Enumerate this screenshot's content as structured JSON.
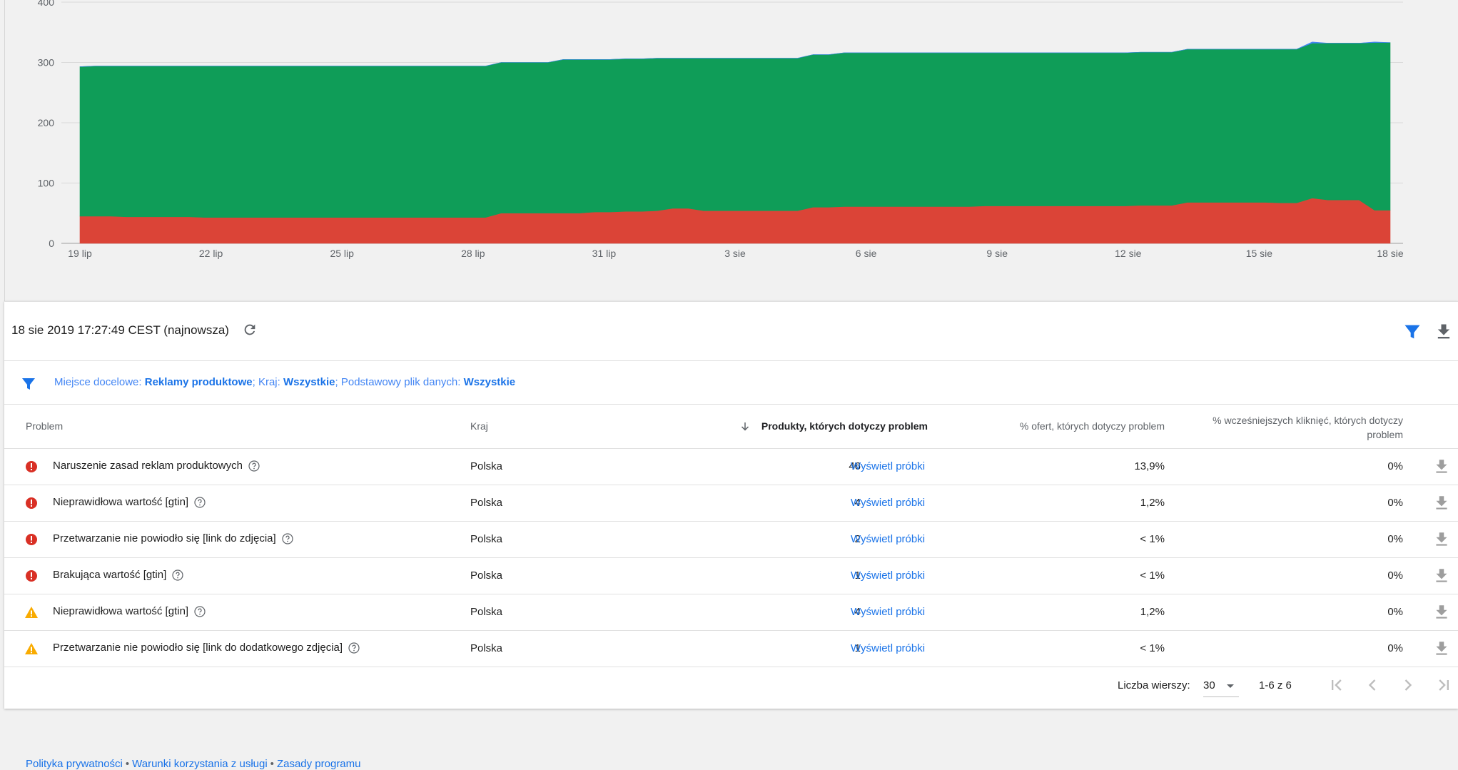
{
  "chart_data": {
    "type": "area",
    "stacked": true,
    "x_tick_labels": [
      "19 lip",
      "22 lip",
      "25 lip",
      "28 lip",
      "31 lip",
      "3 sie",
      "6 sie",
      "9 sie",
      "12 sie",
      "15 sie",
      "18 sie"
    ],
    "y_ticks": [
      0,
      100,
      200,
      300,
      400
    ],
    "ylim": [
      0,
      400
    ],
    "grid": true,
    "series": [
      {
        "color": "#db4437",
        "values": [
          45,
          45,
          45,
          44,
          44,
          44,
          44,
          44,
          43,
          43,
          43,
          43,
          43,
          43,
          43,
          43,
          43,
          43,
          43,
          43,
          43,
          43,
          43,
          43,
          43,
          43,
          43,
          50,
          50,
          50,
          50,
          50,
          50,
          52,
          52,
          53,
          53,
          54,
          58,
          58,
          54,
          54,
          54,
          54,
          54,
          54,
          54,
          60,
          60,
          61,
          61,
          61,
          61,
          61,
          61,
          61,
          61,
          61,
          62,
          62,
          62,
          62,
          62,
          62,
          62,
          62,
          62,
          62,
          63,
          63,
          63,
          68,
          68,
          68,
          68,
          68,
          68,
          67,
          67,
          75,
          72,
          72,
          72,
          55,
          55
        ]
      },
      {
        "color": "#0f9d58",
        "values": [
          248,
          249,
          249,
          250,
          250,
          250,
          250,
          250,
          251,
          251,
          251,
          251,
          251,
          251,
          251,
          251,
          251,
          251,
          251,
          251,
          251,
          251,
          251,
          251,
          251,
          251,
          251,
          250,
          250,
          250,
          250,
          255,
          255,
          253,
          253,
          253,
          253,
          253,
          249,
          249,
          253,
          253,
          253,
          253,
          253,
          253,
          253,
          253,
          253,
          255,
          255,
          255,
          255,
          255,
          255,
          255,
          255,
          255,
          254,
          254,
          254,
          254,
          254,
          254,
          254,
          254,
          254,
          254,
          254,
          254,
          254,
          254,
          254,
          254,
          254,
          254,
          254,
          255,
          255,
          257,
          260,
          260,
          260,
          278,
          278
        ]
      },
      {
        "color": "#4285f4",
        "values": [
          0,
          0,
          0,
          0,
          0,
          0,
          0,
          0,
          0,
          0,
          0,
          0,
          0,
          0,
          0,
          0,
          0,
          0,
          0,
          0,
          0,
          0,
          0,
          0,
          0,
          0,
          0,
          0,
          0,
          0,
          0,
          0,
          0,
          0,
          0,
          0,
          0,
          0,
          0,
          0,
          0,
          0,
          0,
          0,
          0,
          0,
          0,
          0,
          0,
          0,
          0,
          0,
          0,
          0,
          0,
          0,
          0,
          0,
          0,
          0,
          0,
          0,
          0,
          0,
          0,
          0,
          0,
          0,
          0,
          0,
          0,
          0,
          0,
          0,
          0,
          0,
          0,
          0,
          0,
          2,
          0,
          0,
          0,
          1,
          0
        ]
      }
    ]
  },
  "toolbar": {
    "timestamp": "18 sie 2019 17:27:49 CEST (najnowsza)",
    "refresh_icon": "refresh-icon",
    "filter_icon": "filter-icon",
    "download_icon": "download-icon"
  },
  "filters": {
    "placement_label": "Miejsce docelowe:",
    "placement_value": "Reklamy produktowe",
    "country_label": "; Kraj:",
    "country_value": "Wszystkie",
    "feed_label": "; Podstawowy plik danych:",
    "feed_value": "Wszystkie"
  },
  "table": {
    "columns": {
      "problem": "Problem",
      "country": "Kraj",
      "products": "Produkty, których dotyczy problem",
      "offers_pct": "% ofert, których dotyczy problem",
      "clicks_pct_line1": "% wcześniejszych kliknięć, których dotyczy",
      "clicks_pct_line2": "problem"
    },
    "sort_icon": "arrow-down-icon",
    "rows": [
      {
        "severity": "error",
        "problem": "Naruszenie zasad reklam produktowych",
        "country": "Polska",
        "products": "46",
        "link": "Wyświetl próbki",
        "offers_pct": "13,9%",
        "clicks_pct": "0%"
      },
      {
        "severity": "error",
        "problem": "Nieprawidłowa wartość [gtin]",
        "country": "Polska",
        "products": "4",
        "link": "Wyświetl próbki",
        "offers_pct": "1,2%",
        "clicks_pct": "0%"
      },
      {
        "severity": "error",
        "problem": "Przetwarzanie nie powiodło się [link do zdjęcia]",
        "country": "Polska",
        "products": "2",
        "link": "Wyświetl próbki",
        "offers_pct": "< 1%",
        "clicks_pct": "0%"
      },
      {
        "severity": "error",
        "problem": "Brakująca wartość [gtin]",
        "country": "Polska",
        "products": "1",
        "link": "Wyświetl próbki",
        "offers_pct": "< 1%",
        "clicks_pct": "0%"
      },
      {
        "severity": "warning",
        "problem": "Nieprawidłowa wartość [gtin]",
        "country": "Polska",
        "products": "4",
        "link": "Wyświetl próbki",
        "offers_pct": "1,2%",
        "clicks_pct": "0%"
      },
      {
        "severity": "warning",
        "problem": "Przetwarzanie nie powiodło się [link do dodatkowego zdjęcia]",
        "country": "Polska",
        "products": "1",
        "link": "Wyświetl próbki",
        "offers_pct": "< 1%",
        "clicks_pct": "0%"
      }
    ]
  },
  "pagination": {
    "rows_label": "Liczba wierszy:",
    "rows_value": "30",
    "range": "1-6 z 6"
  },
  "colors": {
    "error": "#d93025",
    "warning": "#f9ab00",
    "link": "#1a73e8"
  },
  "footer": {
    "links": [
      "Polityka prywatności",
      "Warunki korzystania z usługi",
      "Zasady programu"
    ],
    "separator": "•"
  }
}
